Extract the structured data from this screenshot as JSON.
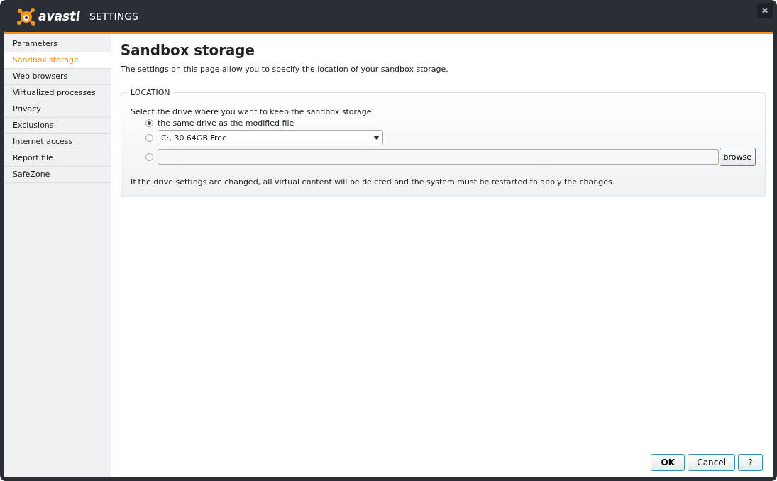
{
  "window": {
    "logo": "avast!",
    "title": "SETTINGS",
    "close": "✖"
  },
  "sidebar": {
    "items": [
      {
        "label": "Parameters",
        "selected": false
      },
      {
        "label": "Sandbox storage",
        "selected": true
      },
      {
        "label": "Web browsers",
        "selected": false
      },
      {
        "label": "Virtualized processes",
        "selected": false
      },
      {
        "label": "Privacy",
        "selected": false
      },
      {
        "label": "Exclusions",
        "selected": false
      },
      {
        "label": "Internet access",
        "selected": false
      },
      {
        "label": "Report file",
        "selected": false
      },
      {
        "label": "SafeZone",
        "selected": false
      }
    ]
  },
  "page": {
    "title": "Sandbox storage",
    "description": "The settings on this page allow you to specify the location of your sandbox storage.",
    "location": {
      "legend": "LOCATION",
      "prompt": "Select the drive where you want to keep the sandbox storage:",
      "options": [
        {
          "kind": "text",
          "label": "the same drive as the modified file",
          "selected": true
        },
        {
          "kind": "select",
          "value": "C:, 30.64GB Free",
          "selected": false
        },
        {
          "kind": "path",
          "button": "browse",
          "selected": false
        }
      ],
      "note": "If the drive settings are changed, all virtual content will be deleted and the system must be restarted to apply the changes."
    }
  },
  "buttons": [
    {
      "kind": "primary",
      "label": "OK"
    },
    {
      "kind": "normal",
      "label": "Cancel"
    },
    {
      "kind": "normal",
      "label": "?"
    }
  ]
}
